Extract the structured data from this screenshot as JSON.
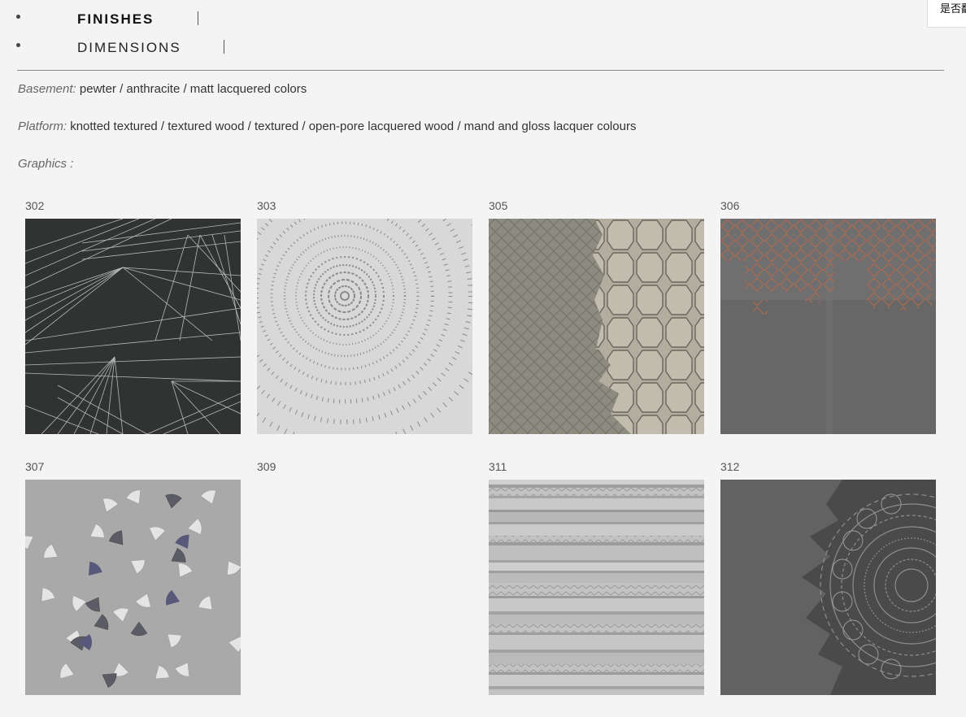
{
  "tabs": [
    {
      "label": "FINISHES",
      "active": true
    },
    {
      "label": "DIMENSIONS",
      "active": false
    }
  ],
  "specs": {
    "basement": {
      "key": "Basement:",
      "value": "pewter / anthracite / matt lacquered colors"
    },
    "platform": {
      "key": "Platform:",
      "value": "knotted textured / textured wood / textured / open-pore lacquered wood / mand and gloss lacquer colours"
    },
    "graphics": {
      "key": "Graphics :",
      "value": ""
    }
  },
  "corner_widget": {
    "text": "是否翻"
  },
  "swatches": [
    {
      "code": "302",
      "pattern": "geometric-lines-dark",
      "image": true
    },
    {
      "code": "303",
      "pattern": "radial-rings-light",
      "image": true
    },
    {
      "code": "305",
      "pattern": "hexagon-lattice-bronze",
      "image": true
    },
    {
      "code": "306",
      "pattern": "copper-diamonds-on-concrete",
      "image": true
    },
    {
      "code": "307",
      "pattern": "ginkgo-leaves-grey",
      "image": true
    },
    {
      "code": "309",
      "pattern": "none",
      "image": false
    },
    {
      "code": "311",
      "pattern": "striped-ethnic-grey",
      "image": true
    },
    {
      "code": "312",
      "pattern": "mandala-dark-grey",
      "image": true
    }
  ]
}
